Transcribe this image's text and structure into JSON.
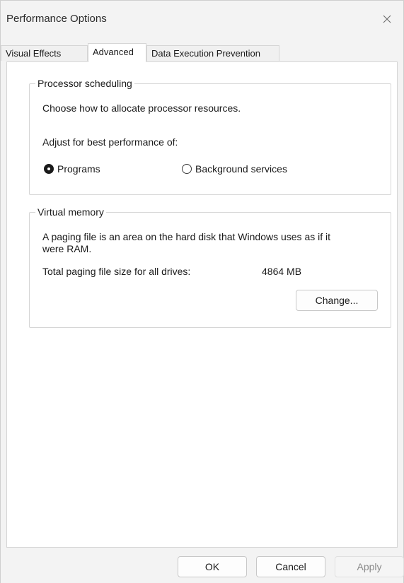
{
  "window": {
    "title": "Performance Options"
  },
  "tabs": [
    {
      "label": "Visual Effects"
    },
    {
      "label": "Advanced"
    },
    {
      "label": "Data Execution Prevention"
    }
  ],
  "processor_scheduling": {
    "legend": "Processor scheduling",
    "description": "Choose how to allocate processor resources.",
    "adjust_label": "Adjust for best performance of:",
    "options": [
      {
        "label": "Programs",
        "selected": true
      },
      {
        "label": "Background services",
        "selected": false
      }
    ]
  },
  "virtual_memory": {
    "legend": "Virtual memory",
    "description_line1": "A paging file is an area on the hard disk that Windows uses as if it",
    "description_line2": "were RAM.",
    "total_label": "Total paging file size for all drives:",
    "total_value": "4864 MB",
    "change_button": "Change..."
  },
  "footer": {
    "ok": "OK",
    "cancel": "Cancel",
    "apply": "Apply"
  },
  "icons": {
    "close": "close-icon"
  }
}
